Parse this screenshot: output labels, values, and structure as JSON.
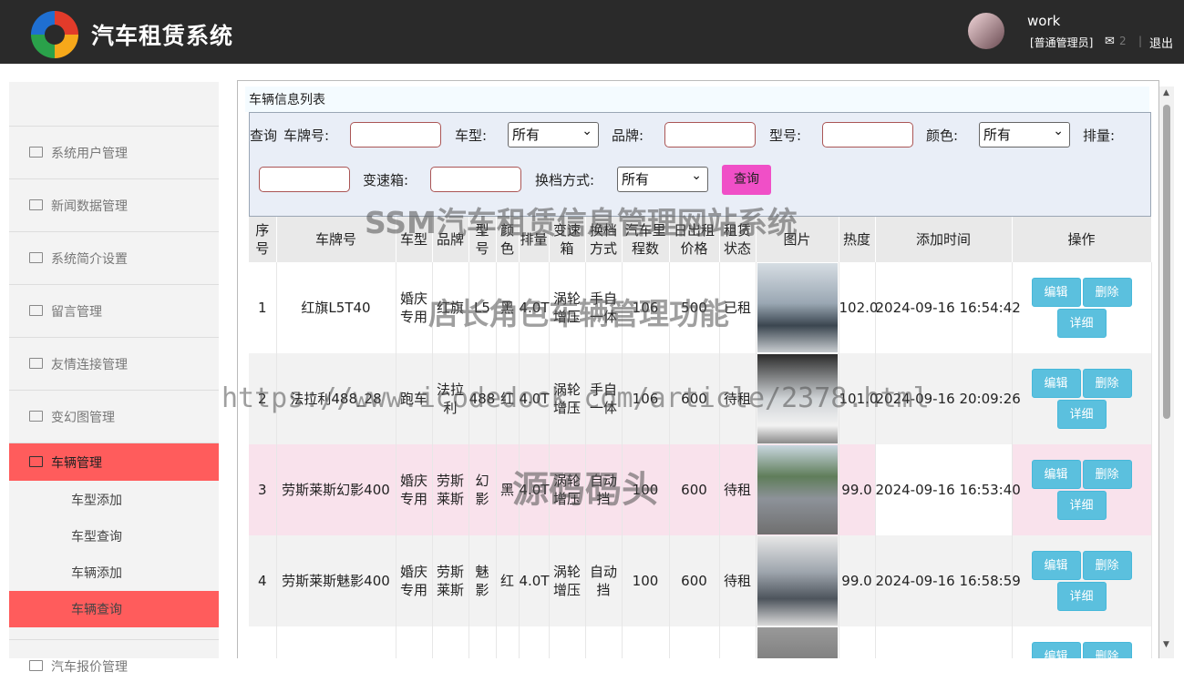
{
  "header": {
    "app_title": "汽车租赁系统",
    "username": "work",
    "role": "[普通管理员]",
    "mail_count": "2",
    "separator": "|",
    "logout": "退出"
  },
  "sidebar": {
    "items": [
      {
        "label": "系统用户管理"
      },
      {
        "label": "新闻数据管理"
      },
      {
        "label": "系统简介设置"
      },
      {
        "label": "留言管理"
      },
      {
        "label": "友情连接管理"
      },
      {
        "label": "变幻图管理"
      },
      {
        "label": "车辆管理"
      },
      {
        "label": "汽车报价管理"
      }
    ],
    "subitems": [
      {
        "label": "车型添加"
      },
      {
        "label": "车型查询"
      },
      {
        "label": "车辆添加"
      },
      {
        "label": "车辆查询"
      }
    ]
  },
  "panel": {
    "title": "车辆信息列表"
  },
  "search": {
    "query_label": "查询",
    "plate_label": "车牌号:",
    "type_label": "车型:",
    "type_value": "所有",
    "brand_label": "品牌:",
    "model_label": "型号:",
    "color_label": "颜色:",
    "color_value": "所有",
    "displacement_label": "排量:",
    "gearbox_label": "变速箱:",
    "shift_label": "换档方式:",
    "shift_value": "所有",
    "submit": "查询"
  },
  "table": {
    "headers": [
      "序号",
      "车牌号",
      "车型",
      "品牌",
      "型号",
      "颜色",
      "排量",
      "变速箱",
      "换档方式",
      "汽车里程数",
      "日出租价格",
      "租赁状态",
      "图片",
      "热度",
      "添加时间",
      "操作"
    ],
    "rows": [
      {
        "no": "1",
        "plate": "红旗L5T40",
        "type": "婚庆专用",
        "brand": "红旗",
        "model": "L5",
        "color": "黑",
        "disp": "4.0T",
        "gearbox": "涡轮增压",
        "shift": "手自一体",
        "mileage": "106",
        "price": "500",
        "status": "已租",
        "heat": "102.0",
        "time": "2024-09-16 16:54:42"
      },
      {
        "no": "2",
        "plate": "法拉利488_28",
        "type": "跑车",
        "brand": "法拉利",
        "model": "488",
        "color": "红",
        "disp": "4.0T",
        "gearbox": "涡轮增压",
        "shift": "手自一体",
        "mileage": "106",
        "price": "600",
        "status": "待租",
        "heat": "101.0",
        "time": "2024-09-16 20:09:26"
      },
      {
        "no": "3",
        "plate": "劳斯莱斯幻影400",
        "type": "婚庆专用",
        "brand": "劳斯莱斯",
        "model": "幻影",
        "color": "黑",
        "disp": "4.0T",
        "gearbox": "涡轮增压",
        "shift": "自动挡",
        "mileage": "100",
        "price": "600",
        "status": "待租",
        "heat": "99.0",
        "time": "2024-09-16 16:53:40"
      },
      {
        "no": "4",
        "plate": "劳斯莱斯魅影400",
        "type": "婚庆专用",
        "brand": "劳斯莱斯",
        "model": "魅影",
        "color": "红",
        "disp": "4.0T",
        "gearbox": "涡轮增压",
        "shift": "自动挡",
        "mileage": "100",
        "price": "600",
        "status": "待租",
        "heat": "99.0",
        "time": "2024-09-16 16:58:59"
      },
      {
        "no": "",
        "plate": "",
        "type": "",
        "brand": "",
        "model": "",
        "color": "",
        "disp": "",
        "gearbox": "",
        "shift": "",
        "mileage": "",
        "price": "",
        "status": "",
        "heat": "",
        "time": ""
      }
    ],
    "actions": {
      "edit": "编辑",
      "delete": "删除",
      "detail": "详细"
    }
  },
  "watermarks": {
    "w1": "SSM汽车租赁信息管理网站系统",
    "w2": "店长角色车辆管理功能",
    "w3": "https://www.icodedock.com/article/2378.html",
    "w4": "源码码头"
  },
  "colors": {
    "accent": "#ff5c5c",
    "action": "#5bc0de",
    "submit": "#f04fc7",
    "topbar": "#2a2a2a"
  }
}
